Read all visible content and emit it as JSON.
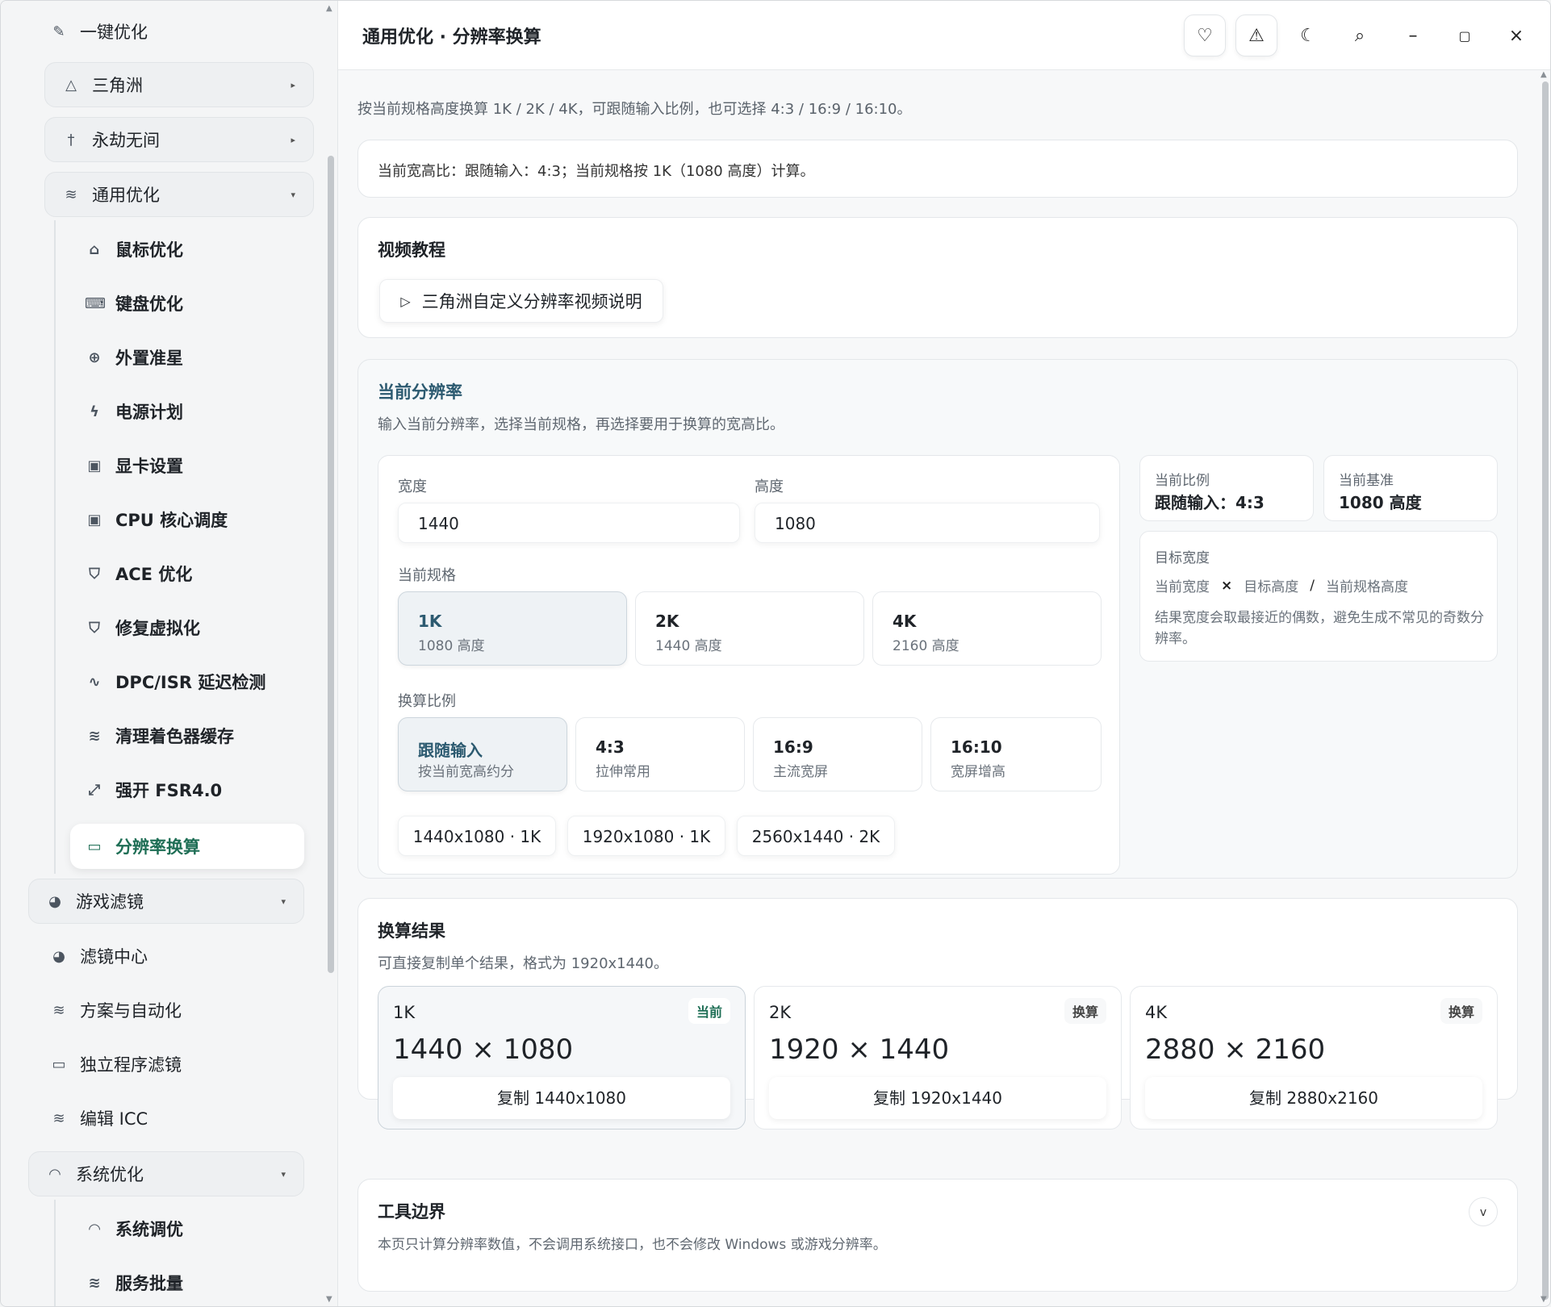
{
  "sidebar": {
    "top": {
      "label": "一键优化",
      "icon": "pin-icon"
    },
    "groups": [
      {
        "label": "三角洲",
        "icon": "triangle-icon"
      },
      {
        "label": "永劫无间",
        "icon": "sword-icon"
      },
      {
        "label": "通用优化",
        "icon": "sliders-icon"
      }
    ],
    "sub": [
      {
        "label": "鼠标优化",
        "icon": "mouse-icon"
      },
      {
        "label": "键盘优化",
        "icon": "keyboard-icon"
      },
      {
        "label": "外置准星",
        "icon": "crosshair-icon"
      },
      {
        "label": "电源计划",
        "icon": "bolt-icon"
      },
      {
        "label": "显卡设置",
        "icon": "chip-icon"
      },
      {
        "label": "CPU 核心调度",
        "icon": "cpu-icon"
      },
      {
        "label": "ACE 优化",
        "icon": "shield-icon"
      },
      {
        "label": "修复虚拟化",
        "icon": "shield-check-icon"
      },
      {
        "label": "DPC/ISR 延迟检测",
        "icon": "pulse-icon"
      },
      {
        "label": "清理着色器缓存",
        "icon": "layers-icon"
      },
      {
        "label": "强开 FSR4.0",
        "icon": "expand-icon"
      },
      {
        "label": "分辨率换算",
        "icon": "monitor-icon"
      }
    ],
    "filters_group": {
      "label": "游戏滤镜",
      "icon": "palette-icon"
    },
    "filters": [
      {
        "label": "滤镜中心",
        "icon": "palette-icon"
      },
      {
        "label": "方案与自动化",
        "icon": "sliders-icon"
      },
      {
        "label": "独立程序滤镜",
        "icon": "monitor-icon"
      },
      {
        "label": "编辑 ICC",
        "icon": "sliders-icon"
      }
    ],
    "system_group": {
      "label": "系统优化",
      "icon": "gauge-icon"
    },
    "system": [
      {
        "label": "系统调优",
        "icon": "gauge-icon"
      },
      {
        "label": "服务批量",
        "icon": "sliders-icon"
      }
    ]
  },
  "header": {
    "title": "通用优化 · 分辨率换算"
  },
  "main": {
    "intro": "按当前规格高度换算 1K / 2K / 4K，可跟随输入比例，也可选择 4:3 / 16:9 / 16:10。",
    "status": "当前宽高比：跟随输入：4:3；当前规格按 1K（1080 高度）计算。",
    "video": {
      "title": "视频教程",
      "button": "三角洲自定义分辨率视频说明"
    },
    "current": {
      "title": "当前分辨率",
      "desc": "输入当前分辨率，选择当前规格，再选择要用于换算的宽高比。",
      "width_label": "宽度",
      "width_value": "1440",
      "height_label": "高度",
      "height_value": "1080",
      "spec_label": "当前规格",
      "specs": [
        {
          "t": "1K",
          "s": "1080 高度"
        },
        {
          "t": "2K",
          "s": "1440 高度"
        },
        {
          "t": "4K",
          "s": "2160 高度"
        }
      ],
      "ratio_label": "换算比例",
      "ratios": [
        {
          "t": "跟随输入",
          "s": "按当前宽高约分"
        },
        {
          "t": "4:3",
          "s": "拉伸常用"
        },
        {
          "t": "16:9",
          "s": "主流宽屏"
        },
        {
          "t": "16:10",
          "s": "宽屏增高"
        }
      ],
      "presets": [
        "1440x1080 · 1K",
        "1920x1080 · 1K",
        "2560x1440 · 2K"
      ],
      "ratio_box": {
        "label": "当前比例",
        "value": "跟随输入：4:3"
      },
      "base_box": {
        "label": "当前基准",
        "value": "1080 高度"
      },
      "formula": {
        "title": "目标宽度",
        "a": "当前宽度",
        "op1": "×",
        "b": "目标高度",
        "op2": "/",
        "c": "当前规格高度",
        "note": "结果宽度会取最接近的偶数，避免生成不常见的奇数分辨率。"
      }
    },
    "results": {
      "title": "换算结果",
      "desc": "可直接复制单个结果，格式为 1920x1440。",
      "items": [
        {
          "level": "1K",
          "tag": "当前",
          "value": "1440 × 1080",
          "copy": "复制 1440x1080"
        },
        {
          "level": "2K",
          "tag": "换算",
          "value": "1920 × 1440",
          "copy": "复制 1920x1440"
        },
        {
          "level": "4K",
          "tag": "换算",
          "value": "2880 × 2160",
          "copy": "复制 2880x2160"
        }
      ]
    },
    "boundary": {
      "title": "工具边界",
      "desc": "本页只计算分辨率数值，不会调用系统接口，也不会修改 Windows 或游戏分辨率。"
    }
  },
  "colors": {
    "accent": "#1e6e55",
    "title_blue": "#2c5a70"
  }
}
